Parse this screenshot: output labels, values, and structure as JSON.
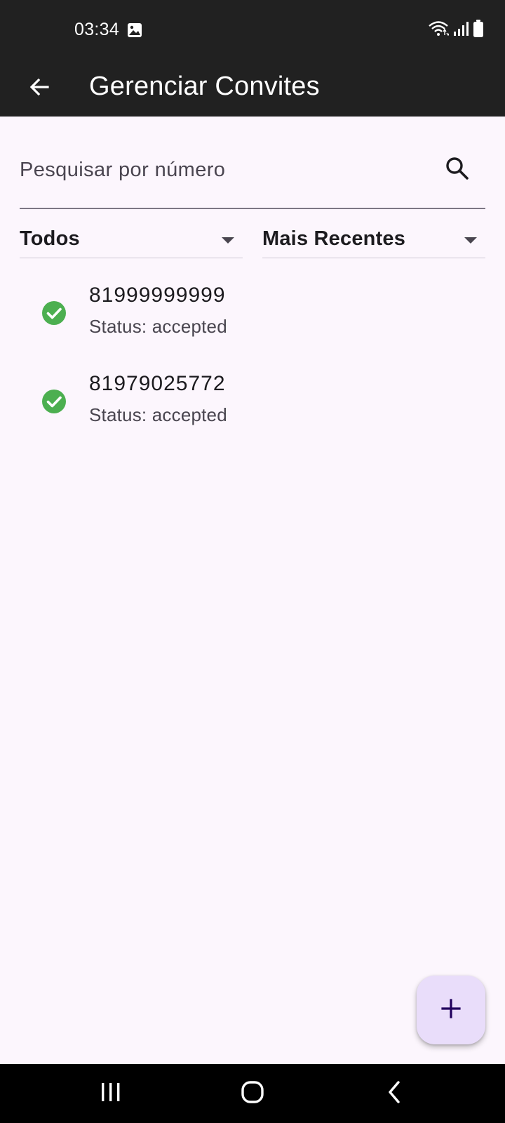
{
  "status_bar": {
    "time": "03:34",
    "icons": [
      "image-icon",
      "wifi-icon",
      "signal-icon",
      "battery-icon"
    ]
  },
  "app_bar": {
    "title": "Gerenciar Convites",
    "back_icon": "arrow-back-icon"
  },
  "search": {
    "placeholder": "Pesquisar por número",
    "value": "",
    "icon": "search-icon"
  },
  "filters": {
    "status_filter": {
      "selected": "Todos"
    },
    "sort_order": {
      "selected": "Mais Recentes"
    }
  },
  "invites": [
    {
      "number": "81999999999",
      "status": "Status: accepted",
      "icon": "check-circle-icon"
    },
    {
      "number": "81979025772",
      "status": "Status: accepted",
      "icon": "check-circle-icon"
    }
  ],
  "fab": {
    "icon": "plus-icon"
  },
  "nav_bar": {
    "icons": [
      "recents-icon",
      "home-icon",
      "back-icon"
    ]
  },
  "colors": {
    "app_bar_bg": "#212121",
    "background": "#fcf6fd",
    "accepted_green": "#4caf50",
    "fab_bg": "#e9ddfa",
    "fab_icon": "#21005d"
  }
}
